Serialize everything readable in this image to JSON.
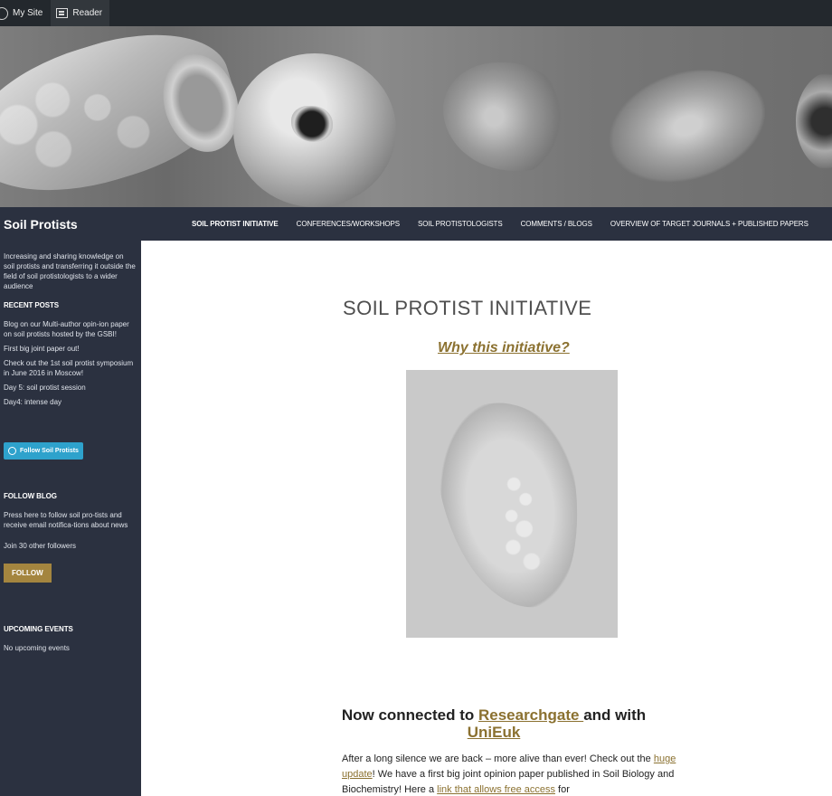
{
  "adminbar": {
    "my_site": "My Site",
    "reader": "Reader"
  },
  "site": {
    "title": "Soil Protists"
  },
  "menu": {
    "items": [
      "SOIL PROTIST INITIATIVE",
      "CONFERENCES/WORKSHOPS",
      "SOIL PROTISTOLOGISTS",
      "COMMENTS / BLOGS",
      "OVERVIEW OF TARGET JOURNALS + PUBLISHED PAPERS"
    ],
    "current_index": 0
  },
  "sidebar": {
    "description": "Increasing and sharing knowledge on soil protists and transferring it outside the field of soil protistologists to a wider audience",
    "recent_posts_heading": "RECENT POSTS",
    "recent_posts": [
      "Blog on our Multi-author opin-ion paper on soil protists hosted by the GSBI!",
      "First big joint paper out!",
      "Check out the 1st soil protist symposium in June 2016 in Moscow!",
      "Day 5: soil protist session",
      "Day4: intense day"
    ],
    "follow_wp_button": "Follow Soil Protists",
    "follow_blog_heading": "FOLLOW BLOG",
    "follow_blog_text": "Press here to follow soil pro-tists and receive email notifica-tions about news",
    "followers_text": "Join 30 other followers",
    "follow_button": "FOLLOW",
    "upcoming_heading": "UPCOMING EVENTS",
    "upcoming_text": "No upcoming events"
  },
  "main": {
    "page_title": "SOIL PROTIST INITIATIVE",
    "subtitle_link": "Why this initiative?",
    "post_title_prefix": "Now connected to ",
    "post_title_link1": "Researchgate ",
    "post_title_middle": "and with ",
    "post_title_link2": "UniEuk",
    "body_part1": "After a long silence we are back – more alive than ever! Check out the ",
    "body_link1": "huge update",
    "body_part2": "! We have a first big joint opinion paper published in Soil Biology and Biochemistry! Here a ",
    "body_link2": "link that allows free access",
    "body_part3": " for"
  },
  "colors": {
    "adminbar": "#23282d",
    "nav_bg": "#2b3140",
    "accent_link": "#8b7130",
    "follow_button": "#a4853f",
    "wp_follow_button": "#2ea2cc"
  }
}
